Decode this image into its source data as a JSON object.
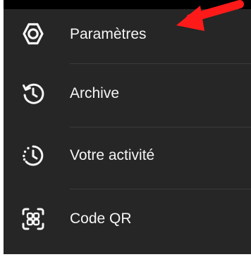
{
  "menu": {
    "items": [
      {
        "icon": "gear-icon",
        "label": "Paramètres"
      },
      {
        "icon": "archive-icon",
        "label": "Archive"
      },
      {
        "icon": "activity-icon",
        "label": "Votre activité"
      },
      {
        "icon": "qr-code-icon",
        "label": "Code QR"
      }
    ]
  },
  "annotation": {
    "icon": "red-arrow-icon",
    "color": "#ff1a1a"
  },
  "colors": {
    "menu_background": "#262626",
    "text": "#f5f5f5",
    "divider": "#3a3a3a",
    "top_bar": "#000000"
  }
}
